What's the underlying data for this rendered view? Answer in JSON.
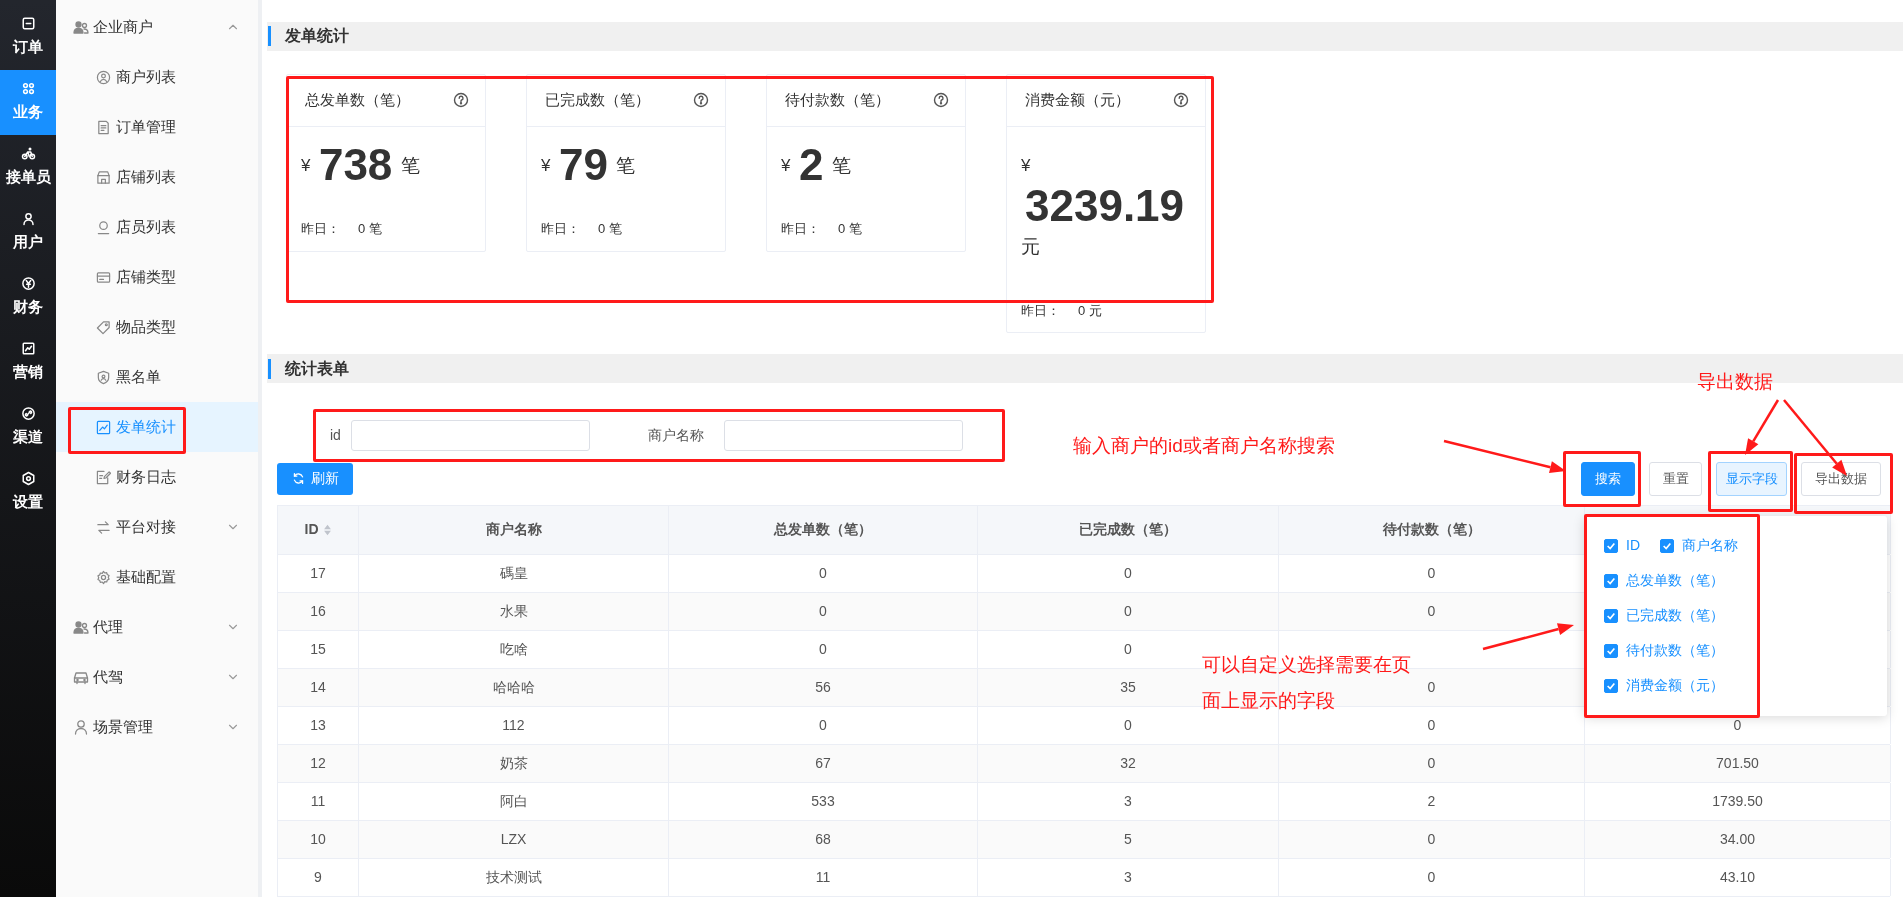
{
  "rail": [
    {
      "label": "订单",
      "selected": false
    },
    {
      "label": "业务",
      "selected": true
    },
    {
      "label": "接单员",
      "selected": false
    },
    {
      "label": "用户",
      "selected": false
    },
    {
      "label": "财务",
      "selected": false
    },
    {
      "label": "营销",
      "selected": false
    },
    {
      "label": "渠道",
      "selected": false
    },
    {
      "label": "设置",
      "selected": false
    }
  ],
  "menu": [
    {
      "label": "企业商户",
      "expanded": true,
      "children": [
        {
          "label": "商户列表",
          "selected": false
        },
        {
          "label": "订单管理",
          "selected": false
        },
        {
          "label": "店铺列表",
          "selected": false
        },
        {
          "label": "店员列表",
          "selected": false
        },
        {
          "label": "店铺类型",
          "selected": false
        },
        {
          "label": "物品类型",
          "selected": false
        },
        {
          "label": "黑名单",
          "selected": false
        },
        {
          "label": "发单统计",
          "selected": true
        },
        {
          "label": "财务日志",
          "selected": false
        },
        {
          "label": "平台对接",
          "selected": false,
          "expanded": false
        },
        {
          "label": "基础配置",
          "selected": false
        }
      ]
    },
    {
      "label": "代理",
      "expanded": false
    },
    {
      "label": "代驾",
      "expanded": false
    },
    {
      "label": "场景管理",
      "expanded": false
    }
  ],
  "stats": {
    "title": "发单统计",
    "cards": [
      {
        "title": "总发单数（笔）",
        "currency": "¥",
        "value": "738",
        "unit": "笔",
        "yesterday_label": "昨日：",
        "yesterday_value": "0 笔"
      },
      {
        "title": "已完成数（笔）",
        "currency": "¥",
        "value": "79",
        "unit": "笔",
        "yesterday_label": "昨日：",
        "yesterday_value": "0 笔"
      },
      {
        "title": "待付款数（笔）",
        "currency": "¥",
        "value": "2",
        "unit": "笔",
        "yesterday_label": "昨日：",
        "yesterday_value": "0 笔"
      },
      {
        "title": "消费金额（元）",
        "currency": "¥",
        "value": "3239.19",
        "unit": "元",
        "yesterday_label": "昨日：",
        "yesterday_value": "0 元"
      }
    ]
  },
  "table_section": {
    "title": "统计表单",
    "filters": [
      {
        "label": "id"
      },
      {
        "label": "商户名称"
      }
    ],
    "refresh_button": "刷新",
    "buttons": [
      {
        "label": "搜索",
        "kind": "primary"
      },
      {
        "label": "重置",
        "kind": "default"
      },
      {
        "label": "显示字段",
        "kind": "active"
      },
      {
        "label": "导出数据",
        "kind": "default"
      }
    ],
    "columns": [
      "ID",
      "商户名称",
      "总发单数（笔）",
      "已完成数（笔）",
      "待付款数（笔）"
    ],
    "rows": [
      {
        "id": "17",
        "name": "碼皇",
        "total": "0",
        "done": "0",
        "pending": "0"
      },
      {
        "id": "16",
        "name": "水果",
        "total": "0",
        "done": "0",
        "pending": "0"
      },
      {
        "id": "15",
        "name": "吃啥",
        "total": "0",
        "done": "0"
      },
      {
        "id": "14",
        "name": "哈哈哈",
        "total": "56",
        "done": "35",
        "pending": "0"
      },
      {
        "id": "13",
        "name": "112",
        "total": "0",
        "done": "0",
        "pending": "0",
        "amount": "0"
      },
      {
        "id": "12",
        "name": "奶茶",
        "total": "67",
        "done": "32",
        "pending": "0",
        "amount": "701.50"
      },
      {
        "id": "11",
        "name": "阿白",
        "total": "533",
        "done": "3",
        "pending": "2",
        "amount": "1739.50"
      },
      {
        "id": "10",
        "name": "LZX",
        "total": "68",
        "done": "5",
        "pending": "0",
        "amount": "34.00"
      },
      {
        "id": "9",
        "name": "技术测试",
        "total": "11",
        "done": "3",
        "pending": "0",
        "amount": "43.10"
      }
    ],
    "field_menu": [
      {
        "label": "ID",
        "checked": true
      },
      {
        "label": "商户名称",
        "checked": true
      },
      {
        "label": "总发单数（笔）",
        "checked": true
      },
      {
        "label": "已完成数（笔）",
        "checked": true
      },
      {
        "label": "待付款数（笔）",
        "checked": true
      },
      {
        "label": "消费金额（元）",
        "checked": true
      }
    ]
  },
  "annotations": [
    {
      "text": "导出数据"
    },
    {
      "text": "输入商户的id或者商户名称搜索"
    },
    {
      "text": "可以自定义选择需要在页面上显示的字段"
    }
  ]
}
